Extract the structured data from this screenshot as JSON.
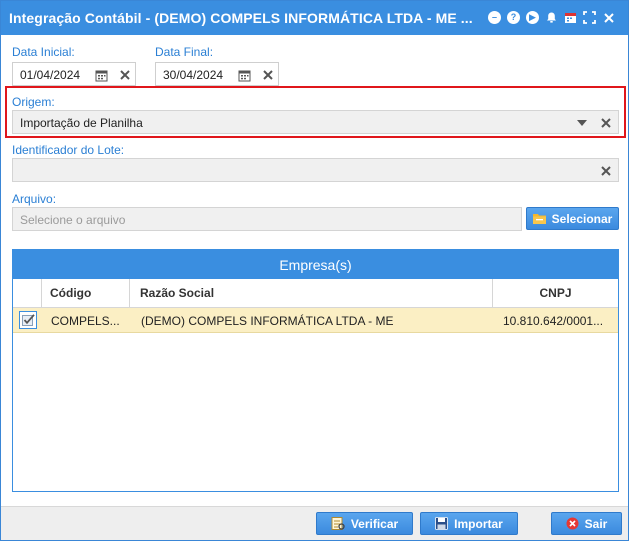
{
  "window": {
    "title": "Integração Contábil - (DEMO) COMPELS INFORMÁTICA LTDA - ME ...",
    "icons": [
      "minimize-icon",
      "help-icon",
      "play-icon",
      "bell-icon",
      "calendar-icon",
      "fullscreen-icon",
      "close-icon"
    ]
  },
  "form": {
    "data_inicial": {
      "label": "Data Inicial:",
      "value": "01/04/2024"
    },
    "data_final": {
      "label": "Data Final:",
      "value": "30/04/2024"
    },
    "origem": {
      "label": "Origem:",
      "value": "Importação de Planilha"
    },
    "lote": {
      "label": "Identificador do Lote:",
      "value": ""
    },
    "arquivo": {
      "label": "Arquivo:",
      "placeholder": "Selecione o arquivo",
      "button": "Selecionar"
    }
  },
  "grid": {
    "title": "Empresa(s)",
    "columns": [
      "Código",
      "Razão Social",
      "CNPJ"
    ],
    "rows": [
      {
        "checked": true,
        "codigo": "COMPELS...",
        "razao": "(DEMO) COMPELS INFORMÁTICA LTDA - ME",
        "cnpj": "10.810.642/0001..."
      }
    ]
  },
  "footer": {
    "verificar": "Verificar",
    "importar": "Importar",
    "sair": "Sair"
  },
  "colors": {
    "accent": "#3a8ee0",
    "label": "#2a7fd4",
    "highlight": "#e0161b",
    "row_selected": "#fbefc4"
  }
}
